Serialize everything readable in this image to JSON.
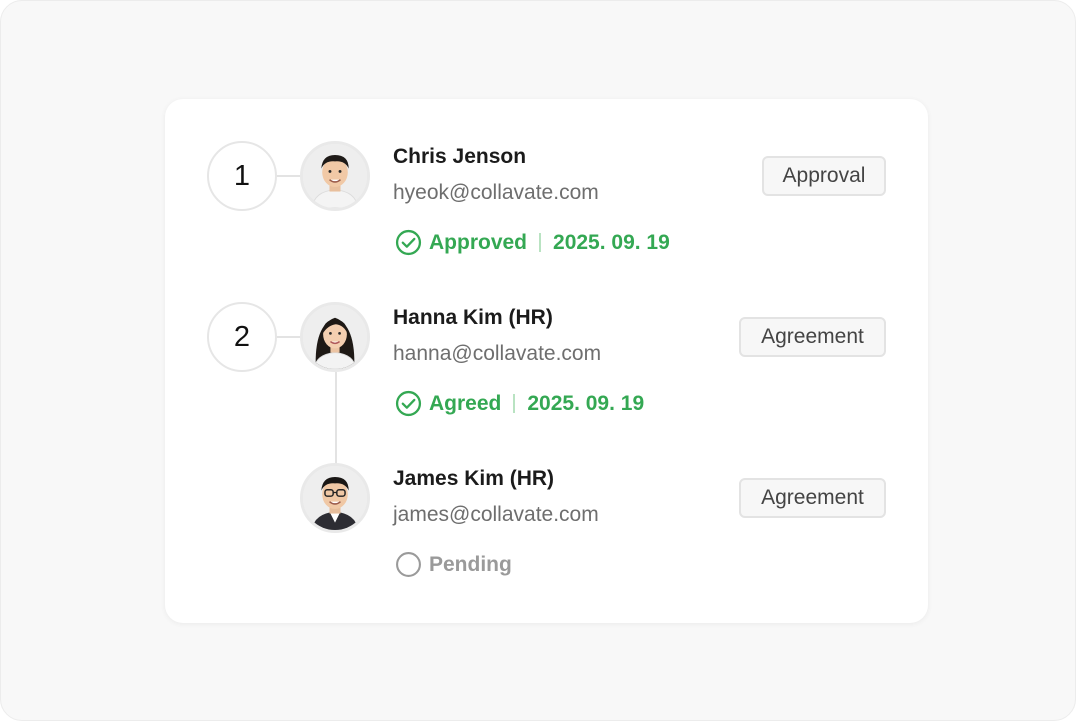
{
  "steps": [
    {
      "number": "1",
      "approvers": [
        {
          "name": "Chris Jenson",
          "email": "hyeok@collavate.com",
          "role": "Approval",
          "status": {
            "label": "Approved",
            "date": "2025. 09. 19",
            "state": "done"
          }
        }
      ]
    },
    {
      "number": "2",
      "approvers": [
        {
          "name": "Hanna Kim (HR)",
          "email": "hanna@collavate.com",
          "role": "Agreement",
          "status": {
            "label": "Agreed",
            "date": "2025. 09. 19",
            "state": "done"
          }
        },
        {
          "name": "James Kim (HR)",
          "email": "james@collavate.com",
          "role": "Agreement",
          "status": {
            "label": "Pending",
            "state": "pending"
          }
        }
      ]
    }
  ],
  "colors": {
    "done": "#34a853",
    "pending": "#9a9a9a",
    "line": "#e3e3e3"
  },
  "icons": {
    "done": "check-circle-icon",
    "pending": "empty-circle-icon"
  }
}
